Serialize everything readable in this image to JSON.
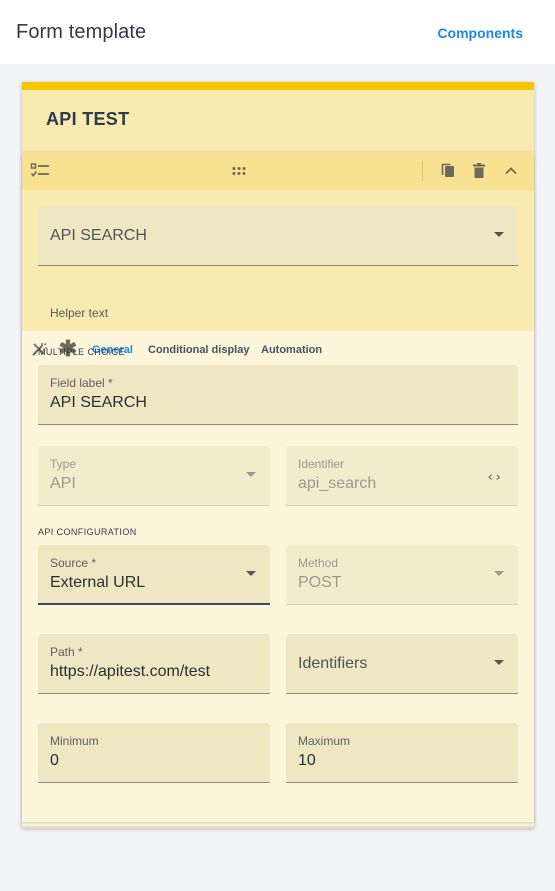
{
  "topbar": {
    "title": "Form template",
    "components_link": "Components"
  },
  "card": {
    "title": "API TEST",
    "accent_color": "#f6c700",
    "toolbar_icons": [
      "checklist-icon",
      "drag-handle-icon",
      "copy-icon",
      "delete-icon",
      "chevron-up-icon"
    ],
    "question": {
      "title_field": {
        "value": "API SEARCH"
      },
      "helper_text": "Helper text",
      "tabs": [
        {
          "label": "General",
          "active": true
        },
        {
          "label": "Conditional display",
          "active": false
        },
        {
          "label": "Automation",
          "active": false
        }
      ]
    },
    "general": {
      "section_caption": "MULTIPLE CHOICE",
      "field_label": {
        "label": "Field label *",
        "value": "API SEARCH"
      },
      "type": {
        "label": "Type",
        "value": "API"
      },
      "identifier": {
        "label": "Identifier",
        "value": "api_search"
      },
      "api_caption": "API CONFIGURATION",
      "source": {
        "label": "Source *",
        "value": "External URL"
      },
      "method": {
        "label": "Method",
        "value": "POST"
      },
      "path": {
        "label": "Path *",
        "value": "https://apitest.com/test"
      },
      "identifiers": {
        "value": "Identifiers"
      },
      "minimum": {
        "label": "Minimum",
        "value": "0"
      },
      "maximum": {
        "label": "Maximum",
        "value": "10"
      }
    }
  }
}
